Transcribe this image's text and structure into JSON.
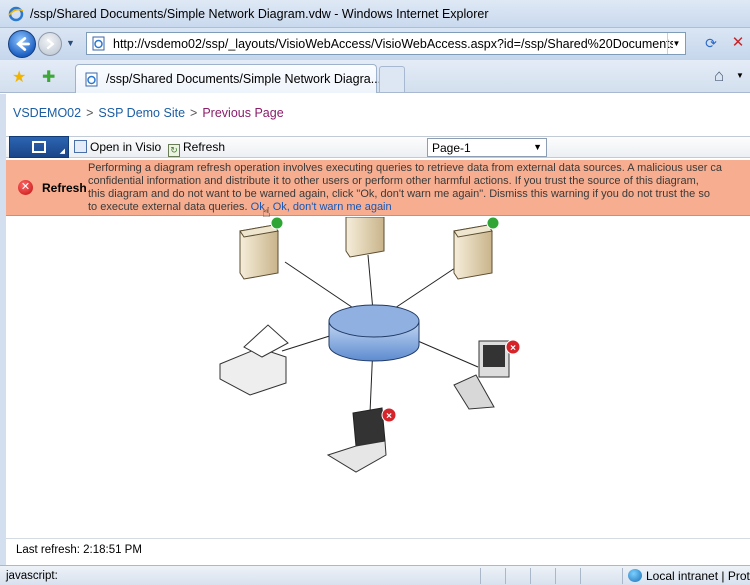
{
  "window": {
    "title": "/ssp/Shared Documents/Simple Network Diagram.vdw - Windows Internet Explorer"
  },
  "address_bar": {
    "url": "http://vsdemo02/ssp/_layouts/VisioWebAccess/VisioWebAccess.aspx?id=/ssp/Shared%20Documents/Simp"
  },
  "tab": {
    "label": "/ssp/Shared Documents/Simple Network Diagra..."
  },
  "breadcrumb": {
    "item1": "VSDEMO02",
    "item2": "SSP Demo Site",
    "item3": "Previous Page",
    "sep": ">"
  },
  "toolbar": {
    "open_in_visio": "Open in Visio",
    "refresh": "Refresh",
    "page_select": "Page-1"
  },
  "warning": {
    "title": "Refresh",
    "line1": "Performing a diagram refresh operation involves executing queries to retrieve data from external data sources. A malicious user ca",
    "line2": "confidential information and distribute it to other users or perform other harmful actions. If you trust the source of this diagram,",
    "line3": "this diagram and do not want to be warned again, click \"Ok, don't warn me again\". Dismiss this warning if you do not trust the so",
    "line4": "to execute external data queries.",
    "ok_link": "Ok",
    "ok_dont_warn_link": "Ok, don't warn me again"
  },
  "footer": {
    "last_refresh": "Last refresh: 2:18:51 PM"
  },
  "status_bar": {
    "status": "javascript:",
    "zone": "Local intranet | Prot"
  },
  "colors": {
    "warning_bg": "#f7ae90",
    "link": "#1c5ea3",
    "visited": "#8a1e6a",
    "hub": "#7fa6dc"
  },
  "diagram": {
    "nodes": [
      "server",
      "server",
      "server",
      "printer",
      "hub",
      "workstation",
      "laptop"
    ],
    "status_icons": [
      "ok",
      "ok",
      "ok",
      "error",
      "error"
    ]
  }
}
